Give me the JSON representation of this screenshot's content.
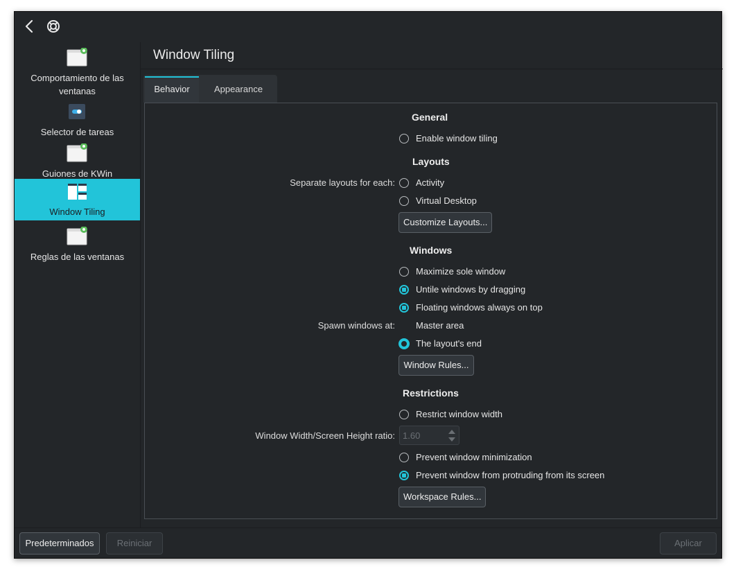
{
  "sidebar": {
    "items": [
      {
        "label": "Comportamiento de las ventanas",
        "icon": "window-settings-icon"
      },
      {
        "label": "Selector de tareas",
        "icon": "task-switcher-icon"
      },
      {
        "label": "Guiones de KWin",
        "icon": "window-settings-icon"
      },
      {
        "label": "Window Tiling",
        "icon": "window-tiling-icon"
      },
      {
        "label": "Reglas de las ventanas",
        "icon": "window-settings-icon"
      }
    ]
  },
  "page": {
    "title": "Window Tiling"
  },
  "tabs": [
    {
      "label": "Behavior",
      "active": true
    },
    {
      "label": "Appearance",
      "active": false
    }
  ],
  "behavior": {
    "general": {
      "heading": "General",
      "enable_tiling": {
        "label": "Enable window tiling",
        "checked": false
      }
    },
    "layouts": {
      "heading": "Layouts",
      "separate_label": "Separate layouts for each:",
      "activity": {
        "label": "Activity",
        "checked": false
      },
      "virtual_desktop": {
        "label": "Virtual Desktop",
        "checked": false
      },
      "customize_button": "Customize Layouts..."
    },
    "windows": {
      "heading": "Windows",
      "maximize_sole": {
        "label": "Maximize sole window",
        "checked": false
      },
      "untile_dragging": {
        "label": "Untile windows by dragging",
        "checked": true
      },
      "floating_on_top": {
        "label": "Floating windows always on top",
        "checked": true
      },
      "spawn_label": "Spawn windows at:",
      "master_area": {
        "label": "Master area",
        "selected": false
      },
      "layout_end": {
        "label": "The layout's end",
        "selected": true
      },
      "rules_button": "Window Rules..."
    },
    "restrictions": {
      "heading": "Restrictions",
      "restrict_width": {
        "label": "Restrict window width",
        "checked": false
      },
      "ratio_label": "Window Width/Screen Height ratio:",
      "ratio_value": "1.60",
      "prevent_minimization": {
        "label": "Prevent window minimization",
        "checked": false
      },
      "prevent_protruding": {
        "label": "Prevent window from protruding from its screen",
        "checked": true
      },
      "workspace_button": "Workspace Rules..."
    }
  },
  "footer": {
    "defaults": "Predeterminados",
    "reset": "Reiniciar",
    "apply": "Aplicar"
  },
  "colors": {
    "accent": "#22c4d9",
    "background": "#232629"
  }
}
